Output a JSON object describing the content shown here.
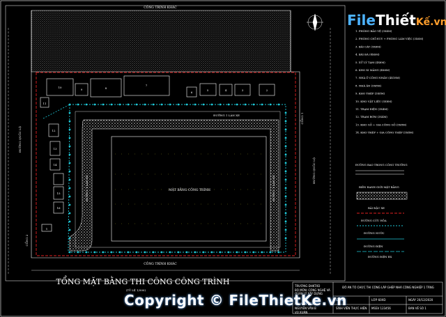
{
  "labels": {
    "top_road": "CÔNG TRÌNH KHÁC",
    "bottom_road": "CÔNG TRÌNH KHÁC",
    "left_road": "ĐƯỜNG QUỐC LỘ",
    "right_road": "ĐƯỜNG QUỐC LỘ",
    "gate_1": "CỔNG 1",
    "gate_2": "CỔNG 2",
    "road_top": "ĐƯỜNG 1 LÀN XE",
    "road_left": "ĐƯỜNG 1 LÀN XE",
    "road_right": "ĐƯỜNG 1 LÀN XE",
    "site_ground": "MẶT BẰNG CÔNG TRÌNH"
  },
  "buildings": {
    "top": [
      "10",
      "9",
      "8",
      "7",
      "6",
      "5",
      "4",
      "3",
      "2"
    ],
    "left": [
      "11",
      "12",
      "13",
      "14",
      "15",
      "16",
      "1"
    ]
  },
  "legend_items": [
    "1. PHÒNG BẢO VỆ (3X4M)",
    "2. PHÒNG CHỈ HUY + PHÒNG LÀM VIỆC (3X6M)",
    "3. BÃI CÁT (5X6M)",
    "4. BÃI ĐÁ (4X6M)",
    "5. XỬ LÝ TẠM (4X6M)",
    "6. KHO XI MĂNG (4X6M)",
    "7. NHÀ Ở CÔNG NHÂN (4X18M)",
    "8. NHÀ ĂN (5X8M)",
    "9. KHO THÉP (5X8M)",
    "10. KHO VẬT LIỆU (5X8M)",
    "11. TRẠM ĐIỆN (3X4M)",
    "12. TRẠM BƠM (3X4M)",
    "13. KHO GỖ + GIA CÔNG GỖ (5X8M)",
    "14. KHO THÉP + GIA CÔNG THÉP (5X8M)"
  ],
  "legend_symbols": {
    "perimeter": "ĐƯỜNG BAO TRONG CÔNG TRƯỜNG",
    "site_boundary": "BIÊN RANH GIỚI MẶT BẰNG",
    "site_road": "BÃI ĐẬU XE",
    "fence": "ĐƯỜNG CỨU HỎA",
    "water": "ĐƯỜNG NƯỚC",
    "power": "ĐƯỜNG ĐIỆN",
    "light": "ĐƯỜNG ĐIỆN RX"
  },
  "drawing_title": "TỔNG MẶT BẰNG THI CÔNG CÔNG TRÌNH",
  "drawing_scale": "(TỶ LỆ 1/500)",
  "title_block": {
    "school": "TRƯỜNG ĐHKTXD",
    "faculty": "BỘ MÔN: CÔNG NGHỆ VÀ QUẢN LÝ XÂY DỰNG",
    "project": "ĐỒ ÁN TỔ CHỨC THI CÔNG LẮP GHÉP NHÀ CÔNG NGHIỆP 1 TẦNG",
    "role_1": "GVHD",
    "role_2": "SINH VIÊN THỰC HIỆN",
    "role_3": "NGUYỄN VĂN A",
    "class": "LỚP 60XD",
    "date": "NGÀY 20/12/2020",
    "sheet": "BẢN VẼ SỐ 1",
    "name_1": "NGUYỄN VĂN B",
    "name_2": "VŨ XUÂN",
    "msv": "MSSV 123456"
  },
  "watermark": "Copyright © FileThietKe.vn",
  "logo": {
    "part1": "File",
    "part2": "Thiết",
    "part3": "Kế.vn"
  },
  "colors": {
    "cyan": "#1ec8d8",
    "red": "#e02020",
    "yellow": "#e0e020",
    "white": "#ffffff",
    "green": "#20c040"
  }
}
